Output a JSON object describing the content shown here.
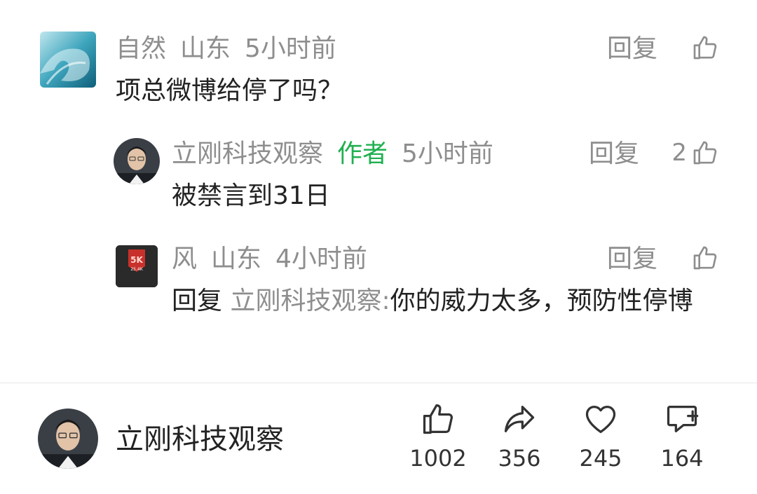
{
  "comments": [
    {
      "username": "自然",
      "location": "山东",
      "time": "5小时前",
      "text": "项总微博给停了吗？",
      "reply_label": "回复"
    },
    {
      "username": "立刚科技观察",
      "author_tag": "作者",
      "time": "5小时前",
      "text": "被禁言到31日",
      "reply_label": "回复",
      "likes": "2"
    },
    {
      "username": "风",
      "location": "山东",
      "time": "4小时前",
      "reply_prefix": "回复",
      "reply_target": "立刚科技观察:",
      "text": "你的威力太多，预防性停博",
      "reply_label": "回复",
      "avatar_badge": "5K",
      "avatar_caption": "25.4K"
    }
  ],
  "footer": {
    "author_name": "立刚科技观察",
    "actions": [
      {
        "name": "like",
        "icon": "thumbs-up-icon",
        "count": "1002"
      },
      {
        "name": "share",
        "icon": "share-arrow-icon",
        "count": "356"
      },
      {
        "name": "favorite",
        "icon": "heart-icon",
        "count": "245"
      },
      {
        "name": "comment",
        "icon": "comment-add-icon",
        "count": "164"
      }
    ]
  },
  "colors": {
    "text": "#222222",
    "meta": "#8e8e8e",
    "author_tag": "#1fb050",
    "divider": "#e6e6e6"
  }
}
